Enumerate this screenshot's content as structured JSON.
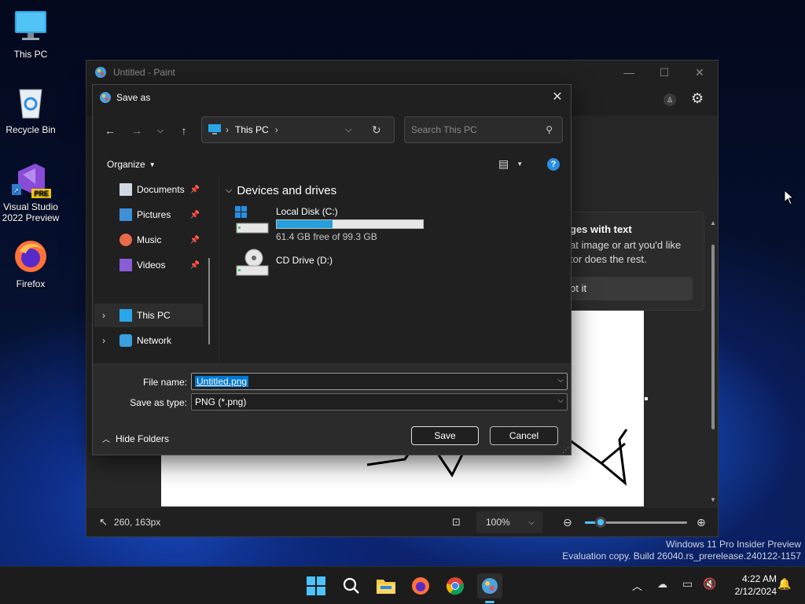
{
  "desktop": {
    "icons": [
      {
        "label": "This PC"
      },
      {
        "label": "Recycle Bin"
      },
      {
        "label": "Visual Studio 2022 Preview",
        "badge": "PRE"
      },
      {
        "label": "Firefox"
      }
    ]
  },
  "paint": {
    "title": "Untitled - Paint",
    "tip": {
      "title": "ges with text",
      "body_line1": "at image or art you'd like",
      "body_line2": "tor does the rest.",
      "button": "Got it"
    },
    "status": {
      "cursor_pos": "260, 163px",
      "zoom": "100%",
      "zoom_fraction": 0.15
    }
  },
  "dialog": {
    "title": "Save as",
    "address": {
      "path": "This PC"
    },
    "search_placeholder": "Search This PC",
    "organize_label": "Organize",
    "sidebar": [
      {
        "label": "Documents",
        "pinned": true
      },
      {
        "label": "Pictures",
        "pinned": true
      },
      {
        "label": "Music",
        "pinned": true
      },
      {
        "label": "Videos",
        "pinned": true
      },
      {
        "label": "This PC",
        "selected": true
      },
      {
        "label": "Network"
      }
    ],
    "group_header": "Devices and drives",
    "drives": [
      {
        "name": "Local Disk (C:)",
        "free_text": "61.4 GB free of 99.3 GB",
        "used_fraction": 0.38
      },
      {
        "name": "CD Drive (D:)"
      }
    ],
    "file_name_label": "File name:",
    "file_name_value": "Untitled.png",
    "save_type_label": "Save as type:",
    "save_type_value": "PNG (*.png)",
    "hide_folders": "Hide Folders",
    "save_button": "Save",
    "cancel_button": "Cancel"
  },
  "watermark": {
    "line1": "Windows 11 Pro Insider Preview",
    "line2": "Evaluation copy. Build 26040.rs_prerelease.240122-1157"
  },
  "taskbar": {
    "time": "4:22 AM",
    "date": "2/12/2024"
  },
  "colors": {
    "accent": "#0078d4",
    "drive_bar_fill": "#26a0da",
    "selection": "#0078d4"
  }
}
